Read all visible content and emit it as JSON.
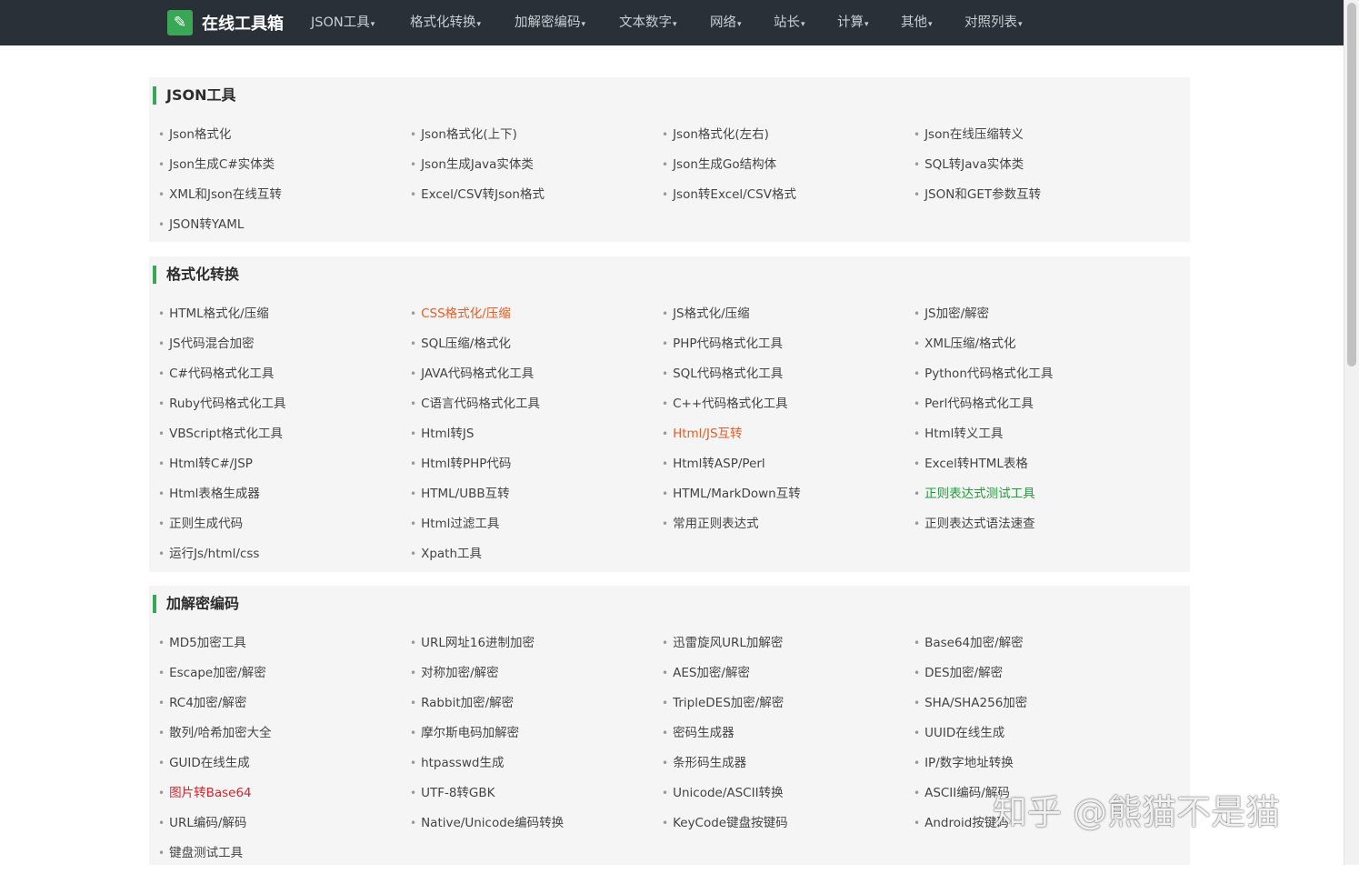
{
  "header": {
    "brand": "在线工具箱",
    "brand_icon": "wrench-icon",
    "nav": [
      "JSON工具",
      "格式化转换",
      "加解密编码",
      "文本数字",
      "网络",
      "站长",
      "计算",
      "其他",
      "对照列表"
    ]
  },
  "colors": {
    "accent": "#3aa757",
    "navbar": "#293038",
    "orange": "#e25f2c",
    "green": "#249a3d",
    "red": "#d9232b"
  },
  "sections": [
    {
      "title": "JSON工具",
      "items": [
        {
          "label": "Json格式化"
        },
        {
          "label": "Json格式化(上下)"
        },
        {
          "label": "Json格式化(左右)"
        },
        {
          "label": "Json在线压缩转义"
        },
        {
          "label": "Json生成C#实体类"
        },
        {
          "label": "Json生成Java实体类"
        },
        {
          "label": "Json生成Go结构体"
        },
        {
          "label": "SQL转Java实体类"
        },
        {
          "label": "XML和Json在线互转"
        },
        {
          "label": "Excel/CSV转Json格式"
        },
        {
          "label": "Json转Excel/CSV格式"
        },
        {
          "label": "JSON和GET参数互转"
        },
        {
          "label": "JSON转YAML"
        }
      ]
    },
    {
      "title": "格式化转换",
      "items": [
        {
          "label": "HTML格式化/压缩"
        },
        {
          "label": "CSS格式化/压缩",
          "color": "orange"
        },
        {
          "label": "JS格式化/压缩"
        },
        {
          "label": "JS加密/解密"
        },
        {
          "label": "JS代码混合加密"
        },
        {
          "label": "SQL压缩/格式化"
        },
        {
          "label": "PHP代码格式化工具"
        },
        {
          "label": "XML压缩/格式化"
        },
        {
          "label": "C#代码格式化工具"
        },
        {
          "label": "JAVA代码格式化工具"
        },
        {
          "label": "SQL代码格式化工具"
        },
        {
          "label": "Python代码格式化工具"
        },
        {
          "label": "Ruby代码格式化工具"
        },
        {
          "label": "C语言代码格式化工具"
        },
        {
          "label": "C++代码格式化工具"
        },
        {
          "label": "Perl代码格式化工具"
        },
        {
          "label": "VBScript格式化工具"
        },
        {
          "label": "Html转JS"
        },
        {
          "label": "Html/JS互转",
          "color": "orange"
        },
        {
          "label": "Html转义工具"
        },
        {
          "label": "Html转C#/JSP"
        },
        {
          "label": "Html转PHP代码"
        },
        {
          "label": "Html转ASP/Perl"
        },
        {
          "label": "Excel转HTML表格"
        },
        {
          "label": "Html表格生成器"
        },
        {
          "label": "HTML/UBB互转"
        },
        {
          "label": "HTML/MarkDown互转"
        },
        {
          "label": "正则表达式测试工具",
          "color": "green"
        },
        {
          "label": "正则生成代码"
        },
        {
          "label": "Html过滤工具"
        },
        {
          "label": "常用正则表达式"
        },
        {
          "label": "正则表达式语法速查"
        },
        {
          "label": "运行Js/html/css"
        },
        {
          "label": "Xpath工具"
        }
      ]
    },
    {
      "title": "加解密编码",
      "items": [
        {
          "label": "MD5加密工具"
        },
        {
          "label": "URL网址16进制加密"
        },
        {
          "label": "迅雷旋风URL加解密"
        },
        {
          "label": "Base64加密/解密"
        },
        {
          "label": "Escape加密/解密"
        },
        {
          "label": "对称加密/解密"
        },
        {
          "label": "AES加密/解密"
        },
        {
          "label": "DES加密/解密"
        },
        {
          "label": "RC4加密/解密"
        },
        {
          "label": "Rabbit加密/解密"
        },
        {
          "label": "TripleDES加密/解密"
        },
        {
          "label": "SHA/SHA256加密"
        },
        {
          "label": "散列/哈希加密大全"
        },
        {
          "label": "摩尔斯电码加解密"
        },
        {
          "label": "密码生成器"
        },
        {
          "label": "UUID在线生成"
        },
        {
          "label": "GUID在线生成"
        },
        {
          "label": "htpasswd生成"
        },
        {
          "label": "条形码生成器"
        },
        {
          "label": "IP/数字地址转换"
        },
        {
          "label": "图片转Base64",
          "color": "red"
        },
        {
          "label": "UTF-8转GBK"
        },
        {
          "label": "Unicode/ASCII转换"
        },
        {
          "label": "ASCII编码/解码"
        },
        {
          "label": "URL编码/解码"
        },
        {
          "label": "Native/Unicode编码转换"
        },
        {
          "label": "KeyCode键盘按键码"
        },
        {
          "label": "Android按键码"
        },
        {
          "label": "键盘测试工具"
        }
      ]
    }
  ],
  "watermark": "知乎 @熊猫不是猫"
}
